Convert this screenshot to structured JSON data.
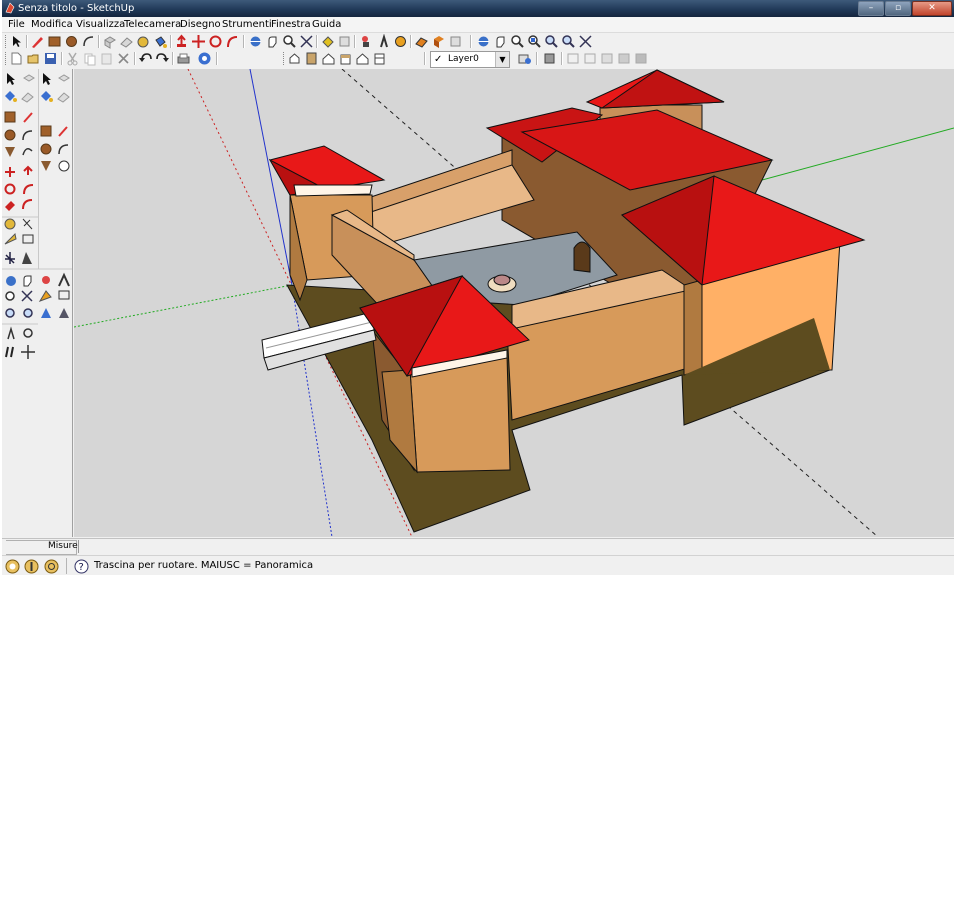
{
  "window": {
    "title": "Senza titolo - SketchUp"
  },
  "menu": [
    "File",
    "Modifica",
    "Visualizza",
    "Telecamera",
    "Disegno",
    "Strumenti",
    "Finestra",
    "Guida"
  ],
  "toolbar": {
    "layer_selected": "Layer0",
    "icons_row1": [
      "select-icon",
      "pencil-icon",
      "rectangle-icon",
      "circle-icon",
      "arc-icon",
      "make-component-icon",
      "eraser-icon",
      "tape-measure-icon",
      "paint-bucket-icon",
      "push-pull-icon",
      "move-icon",
      "rotate-icon",
      "follow-me-icon",
      "orbit-icon",
      "pan-icon",
      "zoom-icon",
      "zoom-extents-icon",
      "previous-view-icon",
      "next-view-icon",
      "position-camera-icon",
      "walk-icon",
      "look-around-icon",
      "section-icon",
      "iso-view-icon",
      "top-view-icon",
      "front-view-icon",
      "right-view-icon",
      "back-view-icon",
      "left-view-icon",
      "orbit-icon",
      "pan-icon",
      "zoom-icon",
      "zoom-window-icon",
      "zoom-extents-icon",
      "previous-view-icon",
      "next-view-icon"
    ],
    "icons_row2": [
      "new-icon",
      "open-icon",
      "save-icon",
      "cut-icon",
      "copy-icon",
      "paste-icon",
      "delete-icon",
      "undo-icon",
      "redo-icon",
      "print-icon",
      "model-info-icon",
      "iso-view-icon",
      "top-view-icon",
      "front-view-icon",
      "right-view-icon",
      "back-view-icon",
      "left-view-icon",
      "layer-manager-icon",
      "xray-icon",
      "wireframe-icon",
      "hidden-line-icon",
      "shaded-icon",
      "textured-icon",
      "monochrome-icon"
    ]
  },
  "sidebar": {
    "tools": [
      "select-icon",
      "make-component-icon",
      "paint-bucket-icon",
      "eraser-icon",
      "rectangle-icon",
      "line-icon",
      "circle-icon",
      "arc-icon",
      "polygon-icon",
      "freehand-icon",
      "move-icon",
      "push-pull-icon",
      "rotate-icon",
      "follow-me-icon",
      "scale-icon",
      "offset-icon",
      "tape-measure-icon",
      "dimension-icon",
      "protractor-icon",
      "text-icon",
      "axes-icon",
      "3d-text-icon",
      "orbit-icon",
      "pan-icon",
      "zoom-icon",
      "zoom-window-icon",
      "zoom-extents-icon",
      "previous-view-icon",
      "position-camera-icon",
      "look-around-icon",
      "walk-icon",
      "section-plane-icon"
    ]
  },
  "measurements": {
    "label": "Misure",
    "value": ""
  },
  "status": {
    "text": "Trascina per ruotare.  MAIUSC = Panoramica"
  },
  "colors": {
    "sky": "#d6d6d6",
    "roof": "#c91414",
    "wall_light": "#f2b168",
    "wall_mid": "#d79a5a",
    "wall_dark": "#8a5a30",
    "base_dark": "#5a4a1e",
    "courtyard": "#8f9aa3",
    "axis_red": "#d22",
    "axis_green": "#3c3",
    "axis_blue": "#22c"
  }
}
